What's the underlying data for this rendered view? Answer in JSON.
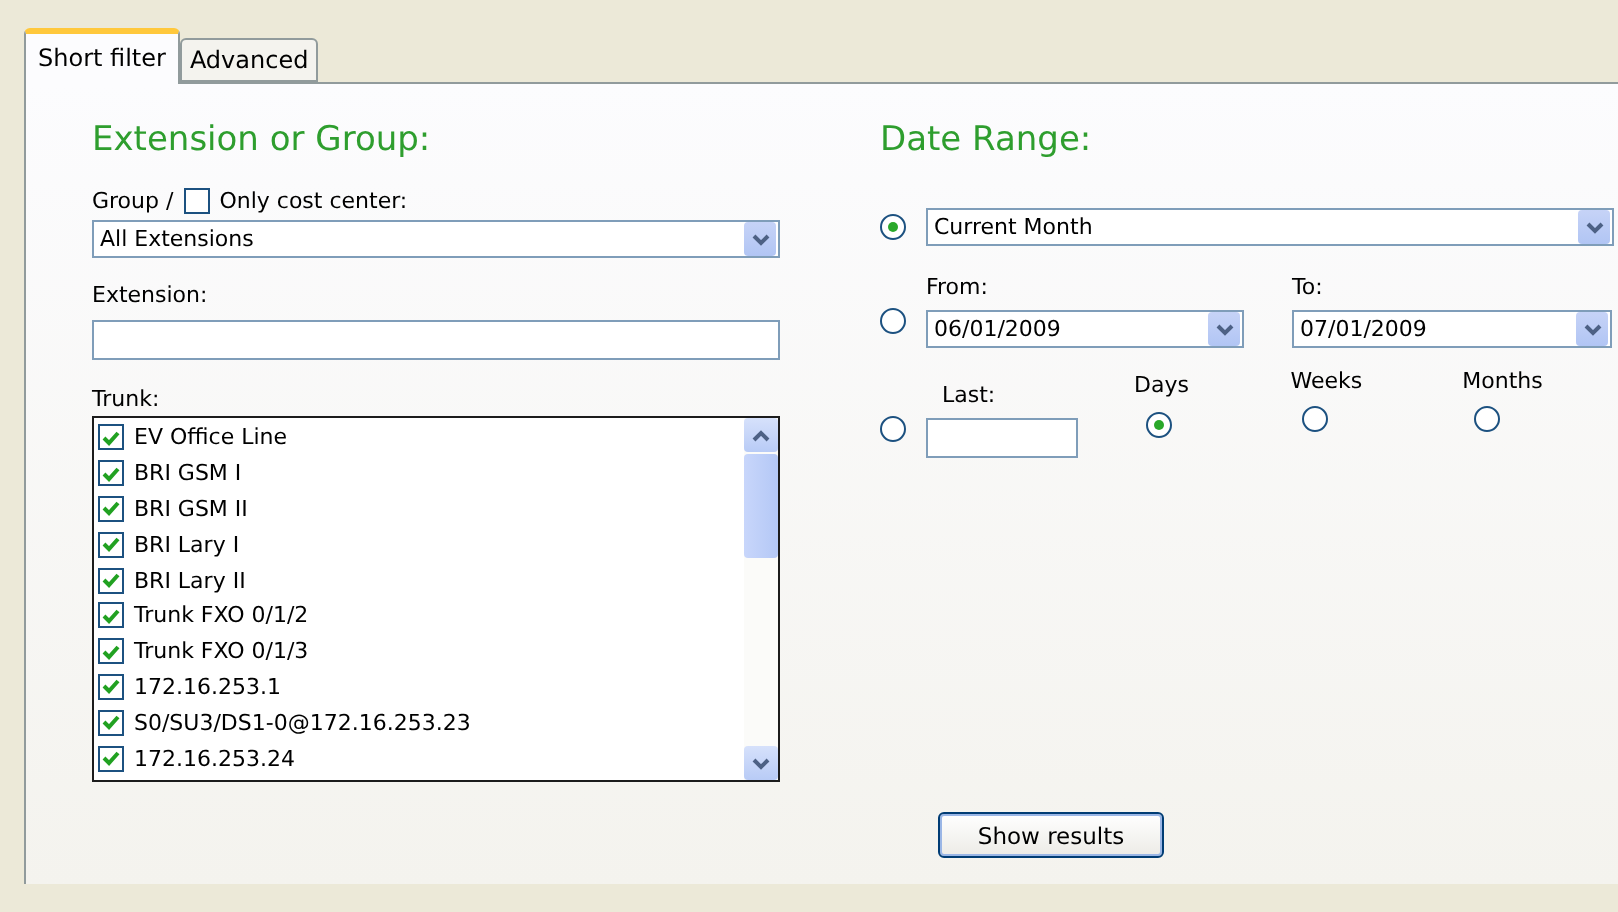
{
  "tabs": [
    {
      "label": "Short filter",
      "selected": true
    },
    {
      "label": "Advanced",
      "selected": false
    }
  ],
  "extension_group": {
    "heading": "Extension or Group:",
    "group_label": "Group /",
    "cost_center": {
      "label": "Only cost center:",
      "checked": false
    },
    "group_select": {
      "value": "All Extensions"
    },
    "extension_label": "Extension:",
    "trunk_label": "Trunk:",
    "trunks": [
      {
        "label": "EV Office Line",
        "checked": true
      },
      {
        "label": "BRI GSM I",
        "checked": true
      },
      {
        "label": "BRI GSM II",
        "checked": true
      },
      {
        "label": "BRI Lary I",
        "checked": true
      },
      {
        "label": "BRI Lary II",
        "checked": true
      },
      {
        "label": "Trunk FXO 0/1/2",
        "checked": true
      },
      {
        "label": "Trunk FXO 0/1/3",
        "checked": true
      },
      {
        "label": "172.16.253.1",
        "checked": true
      },
      {
        "label": "S0/SU3/DS1-0@172.16.253.23",
        "checked": true
      },
      {
        "label": "172.16.253.24",
        "checked": true
      }
    ]
  },
  "date_range": {
    "heading": "Date Range:",
    "options": [
      {
        "kind": "preset",
        "selected": true,
        "value": "Current Month"
      },
      {
        "kind": "range",
        "selected": false,
        "from_label": "From:",
        "from_value": "06/01/2009",
        "to_label": "To:",
        "to_value": "07/01/2009"
      },
      {
        "kind": "last",
        "selected": false,
        "label": "Last:",
        "units": [
          {
            "label": "Days",
            "selected": true
          },
          {
            "label": "Weeks",
            "selected": false
          },
          {
            "label": "Months",
            "selected": false
          }
        ]
      }
    ]
  },
  "show_results_button": "Show results"
}
